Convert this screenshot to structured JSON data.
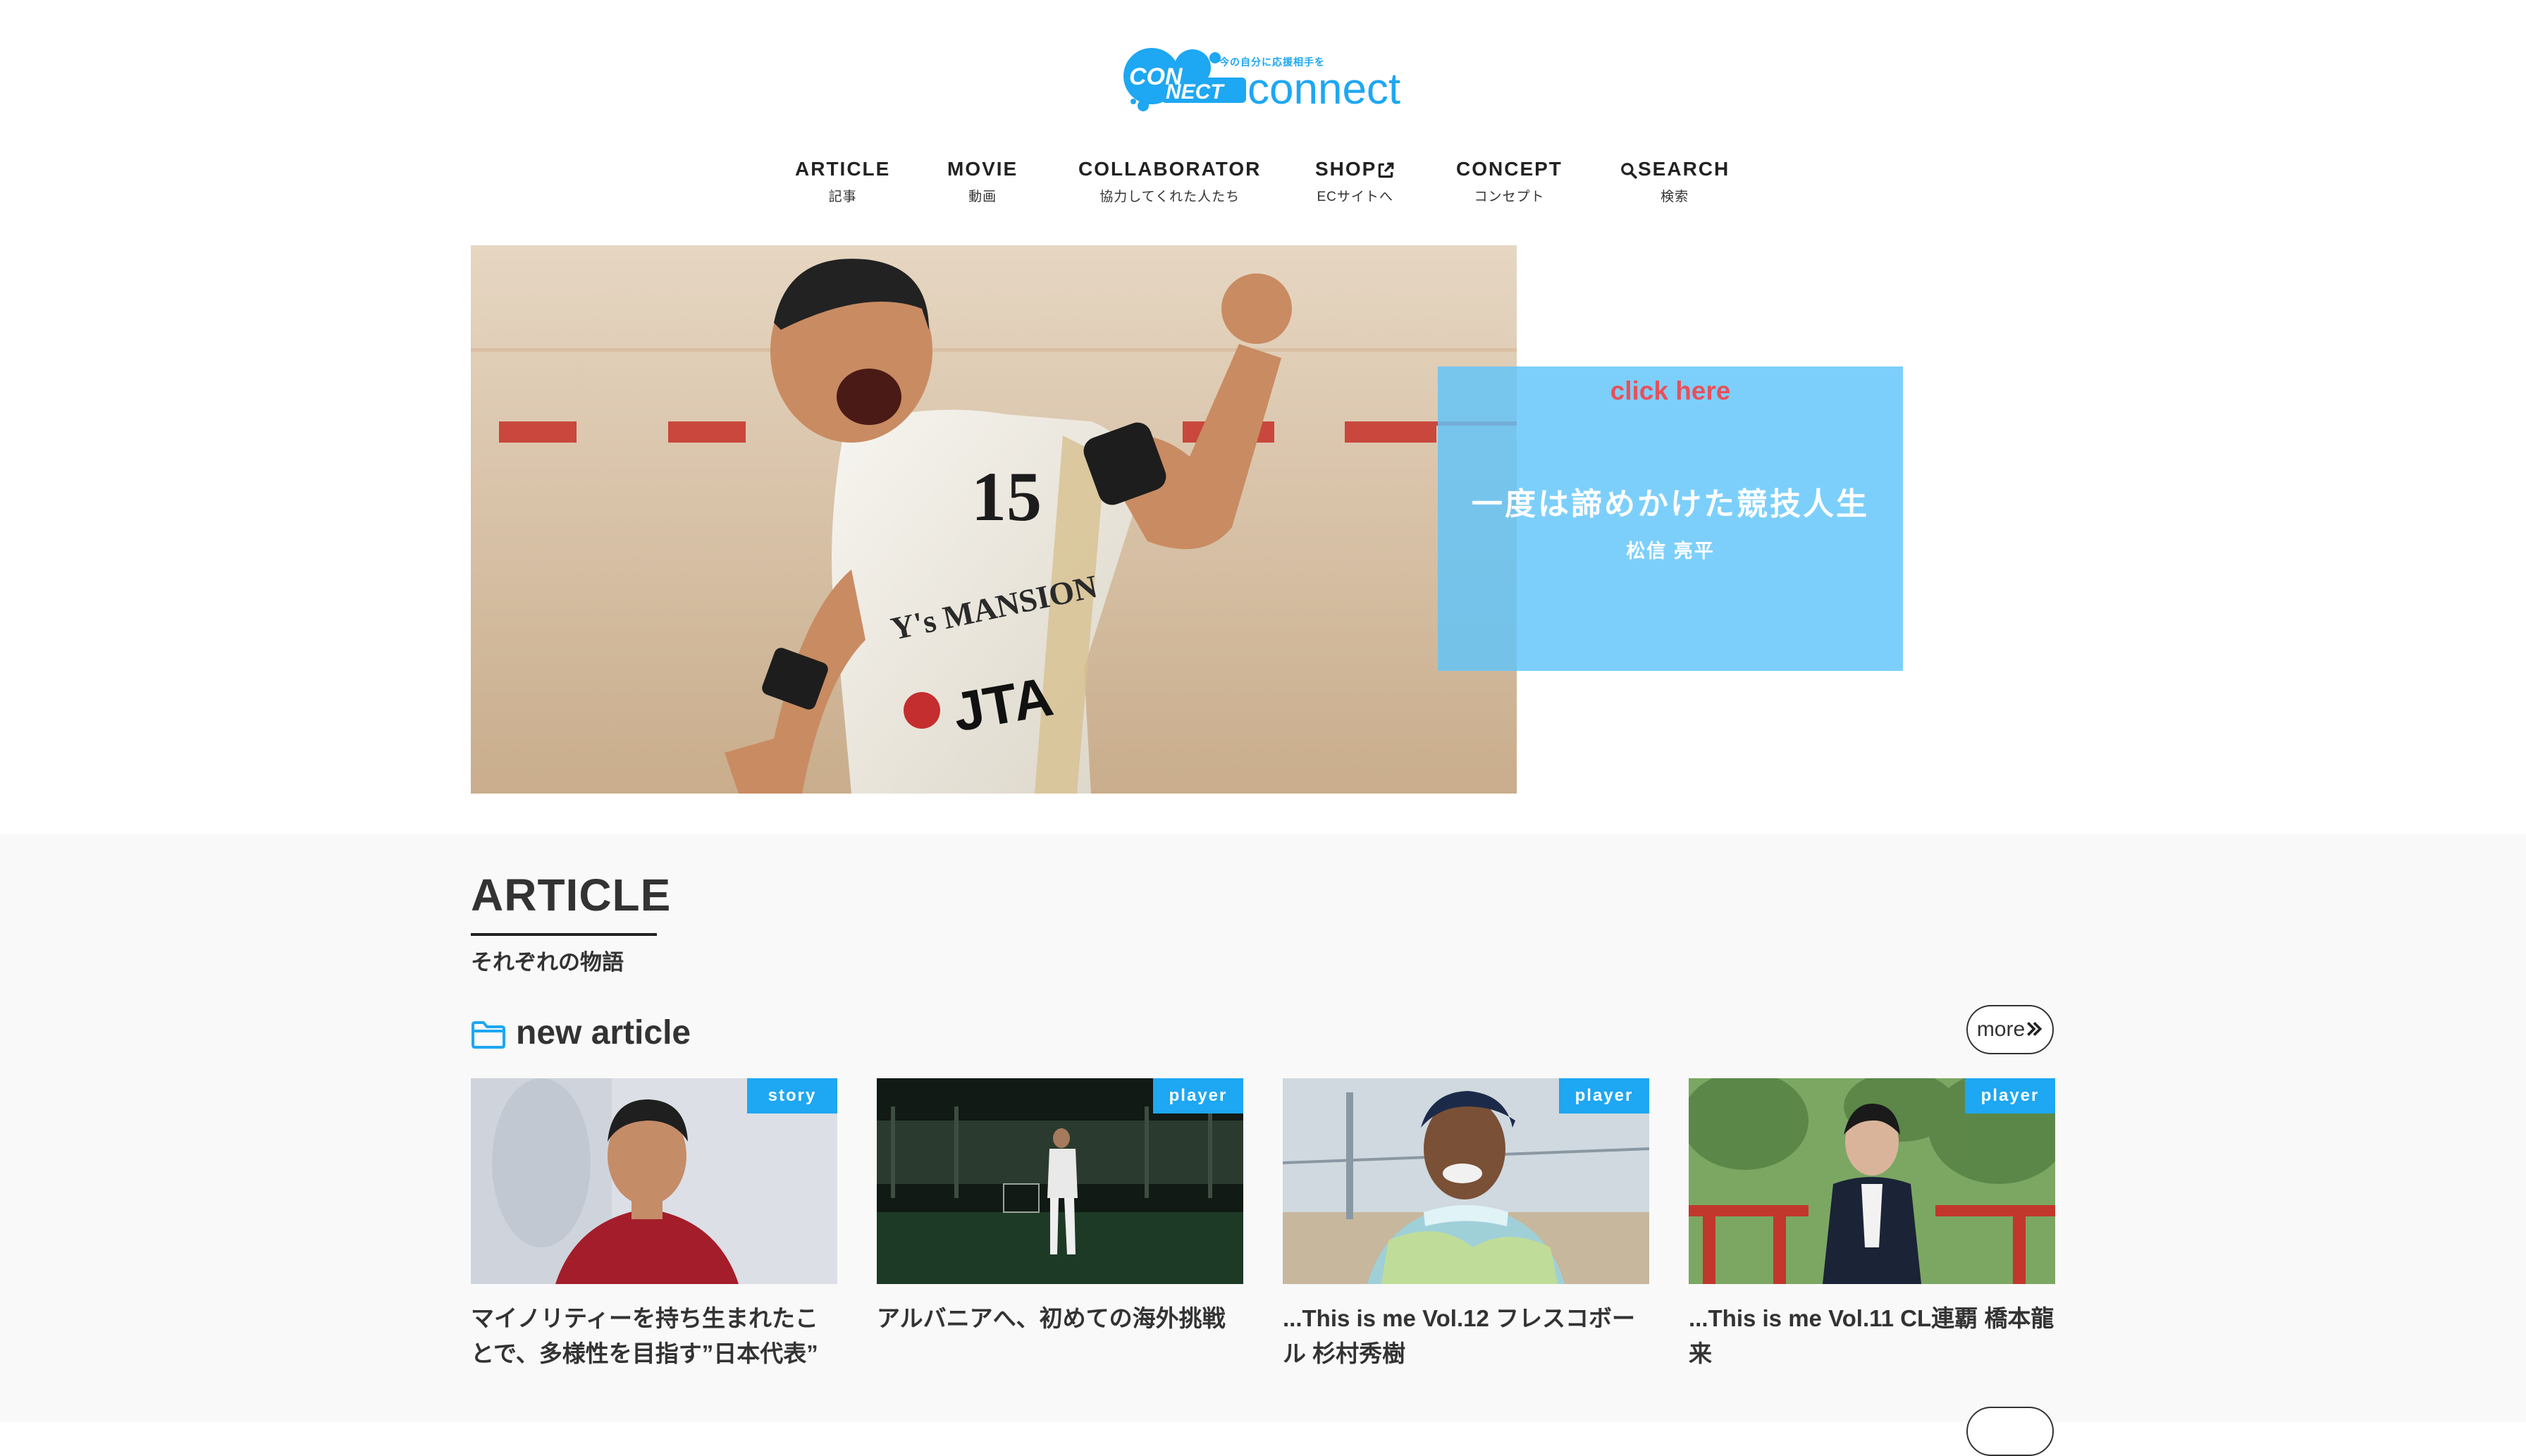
{
  "header": {
    "logo_badge_text": "CONNECT",
    "logo_tagline": "今の自分に応援相手を",
    "logo_word": "connect"
  },
  "nav": {
    "items": [
      {
        "label": "ARTICLE",
        "sub": "記事"
      },
      {
        "label": "MOVIE",
        "sub": "動画"
      },
      {
        "label": "COLLABORATOR",
        "sub": "協力してくれた人たち"
      },
      {
        "label": "SHOP",
        "sub": "ECサイトへ"
      },
      {
        "label": "CONCEPT",
        "sub": "コンセプト"
      },
      {
        "label": "SEARCH",
        "sub": "検索"
      }
    ]
  },
  "hero": {
    "click_text": "click here",
    "title": "一度は諦めかけた競技人生",
    "author": "松信 亮平",
    "jersey_number": "15",
    "sponsor_1": "Y's MANSION",
    "sponsor_2": "JTA"
  },
  "article_section": {
    "title": "ARTICLE",
    "subtitle": "それぞれの物語",
    "new_article_label": "new article",
    "more_label": "more",
    "cards": [
      {
        "tag": "story",
        "title": "マイノリティーを持ち生まれたことで、多様性を目指す”日本代表”"
      },
      {
        "tag": "player",
        "title": "アルバニアへ、初めての海外挑戦"
      },
      {
        "tag": "player",
        "title": "...This is me Vol.12 フレスコボール 杉村秀樹"
      },
      {
        "tag": "player",
        "title": "...This is me Vol.11 CL連覇 橋本龍来"
      }
    ]
  },
  "colors": {
    "accent": "#1ea7f2",
    "hero_card": "#60c4fa",
    "click_here": "#e8505b",
    "section_bg": "#f9f9f9"
  },
  "icons": {
    "shop": "external-link-icon",
    "search": "search-icon",
    "folder": "folder-icon",
    "more": "double-chevron-right-icon"
  }
}
